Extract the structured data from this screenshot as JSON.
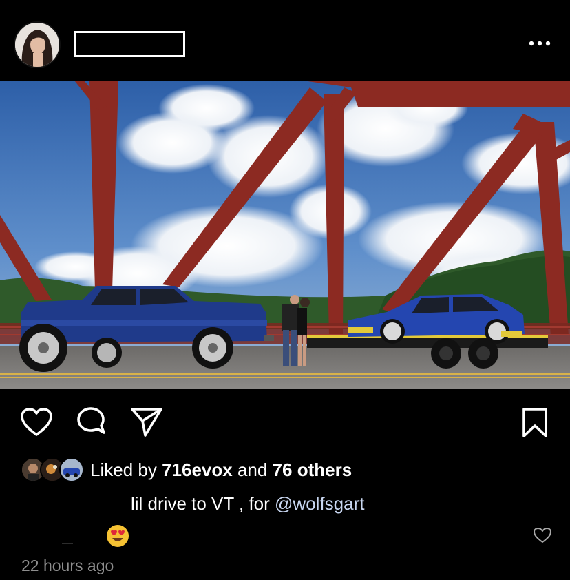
{
  "post": {
    "username_redacted": true,
    "photo_alt": "Photo of a blue pickup truck towing a blue sedan on a trailer across a red steel bridge",
    "likes": {
      "prefix": "Liked by ",
      "user": "716evox",
      "middle": " and ",
      "others": "76 others"
    },
    "caption": {
      "text": "lil drive to VT , for ",
      "mention": "@wolfsgart"
    },
    "comment": {
      "emoji": "😍"
    },
    "timestamp": "22 hours ago"
  },
  "icons": {
    "more": "more-horizontal-icon",
    "like": "heart-icon",
    "comment": "comment-bubble-icon",
    "share": "paper-plane-icon",
    "save": "bookmark-icon",
    "comment_like": "small-heart-icon"
  },
  "colors": {
    "background": "#000000",
    "text": "#ffffff",
    "secondary": "#8e8e8e",
    "mention": "#c8d6f0",
    "bridge_red": "#8c2a22",
    "truck_blue": "#1f3a8a"
  }
}
